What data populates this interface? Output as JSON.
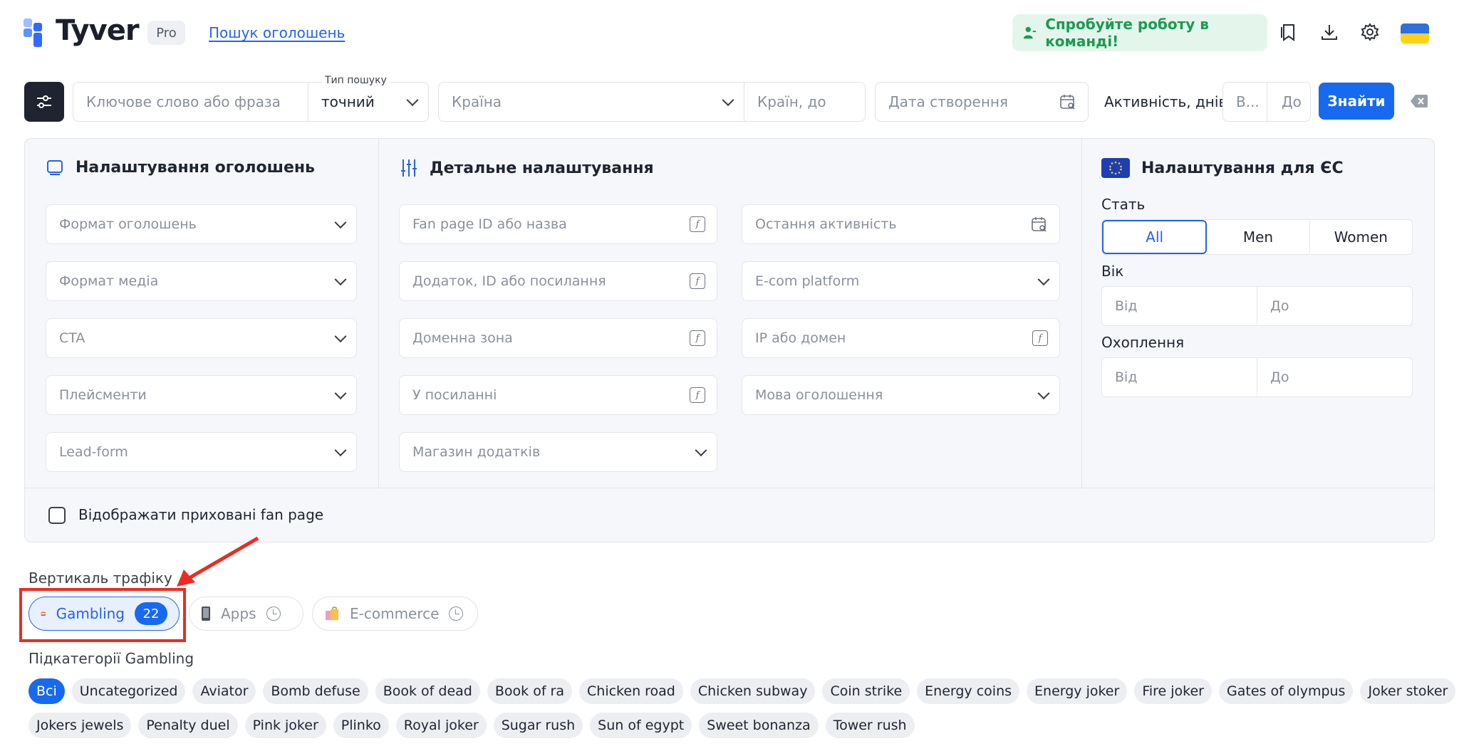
{
  "header": {
    "logo_text": "Tyver",
    "pro_badge": "Pro",
    "search_link": "Пошук оголошень",
    "team_button": "Спробуйте роботу в команді!"
  },
  "search": {
    "keyword_placeholder": "Ключове слово або фраза",
    "search_type_label": "Тип пошуку",
    "search_type_value": "точний",
    "country_placeholder": "Країна",
    "countries_to_placeholder": "Країн, до",
    "date_placeholder": "Дата створення",
    "activity_label": "Активність, днів",
    "activity_from": "В...",
    "activity_to": "До",
    "find_button": "Знайти"
  },
  "ad_settings": {
    "title": "Налаштування оголошень",
    "fields": [
      "Формат оголошень",
      "Формат медіа",
      "CTA",
      "Плейсменти",
      "Lead-form"
    ]
  },
  "detail_settings": {
    "title": "Детальне налаштування",
    "left_fields": [
      "Fan page ID або назва",
      "Додаток, ID або посилання",
      "Доменна зона",
      "У посиланні",
      "Магазин додатків"
    ],
    "right_fields": [
      "Остання активність",
      "E-com platform",
      "IP або домен",
      "Мова оголошення"
    ]
  },
  "eu_settings": {
    "title": "Налаштування для ЄС",
    "gender_label": "Стать",
    "gender_options": [
      "All",
      "Men",
      "Women"
    ],
    "age_label": "Вік",
    "reach_label": "Охоплення",
    "from": "Від",
    "to": "До"
  },
  "hidden_pages_label": "Відображати приховані fan page",
  "verticals": {
    "title": "Вертикаль трафіку",
    "items": [
      {
        "label": "Gambling",
        "count": "22"
      },
      {
        "label": "Apps"
      },
      {
        "label": "E-commerce"
      }
    ]
  },
  "subcategories": {
    "title": "Підкатегорії Gambling",
    "row1": [
      "Всі",
      "Uncategorized",
      "Aviator",
      "Bomb defuse",
      "Book of dead",
      "Book of ra",
      "Chicken road",
      "Chicken subway",
      "Coin strike",
      "Energy coins",
      "Energy joker",
      "Fire joker",
      "Gates of olympus",
      "Joker stoker"
    ],
    "row2": [
      "Jokers jewels",
      "Penalty duel",
      "Pink joker",
      "Plinko",
      "Royal joker",
      "Sugar rush",
      "Sun of egypt",
      "Sweet bonanza",
      "Tower rush"
    ]
  },
  "colors": {
    "accent": "#1769f0",
    "team_green": "#1a9b52",
    "annotation_red": "#ee2b1f"
  }
}
